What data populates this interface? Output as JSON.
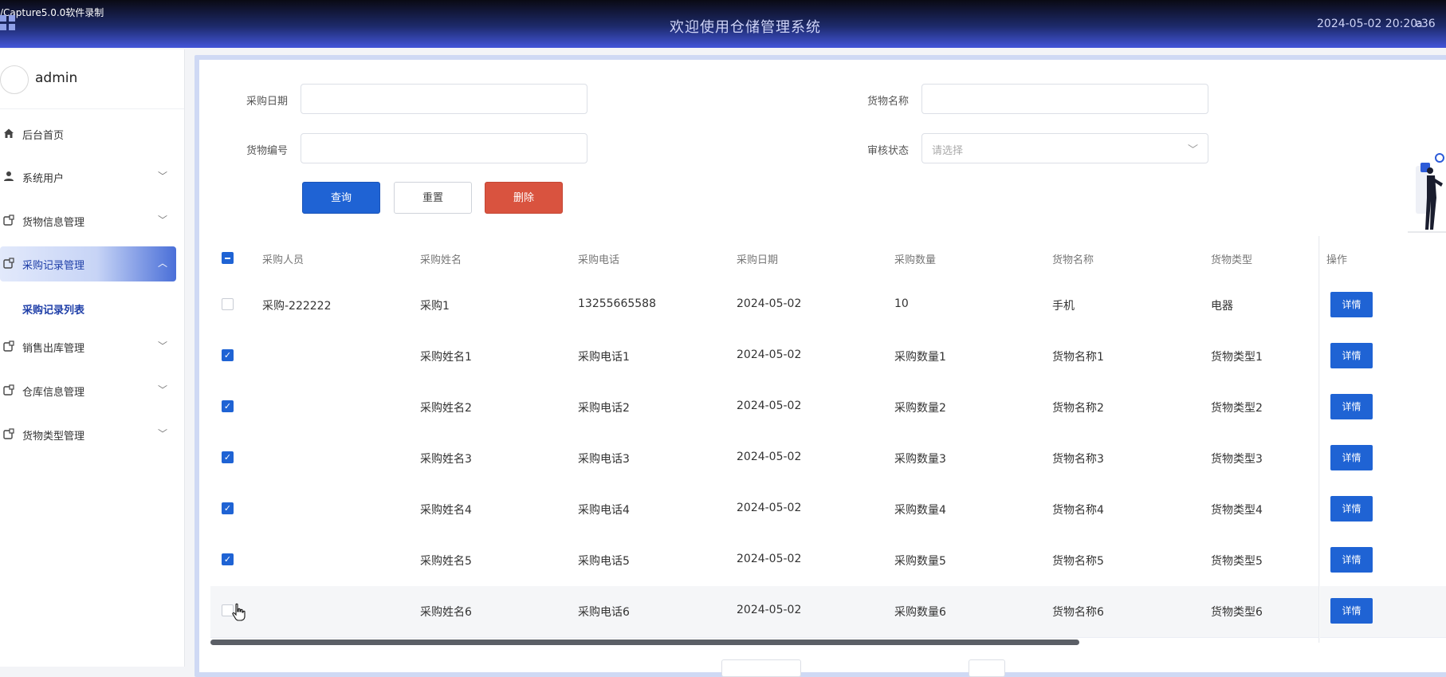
{
  "topbar": {
    "capture_text": "/Capture5.0.0软件录制",
    "title": "欢迎使用仓储管理系统",
    "datetime": "2024-05-02 20:20:36",
    "user_initial": "a"
  },
  "sidebar": {
    "username": "admin",
    "items": [
      {
        "label": "后台首页",
        "icon": "home-icon",
        "has_children": false
      },
      {
        "label": "系统用户",
        "icon": "user-icon",
        "has_children": true
      },
      {
        "label": "货物信息管理",
        "icon": "module-icon",
        "has_children": true
      },
      {
        "label": "采购记录管理",
        "icon": "module-icon",
        "has_children": true,
        "active": true
      },
      {
        "label": "销售出库管理",
        "icon": "module-icon",
        "has_children": true
      },
      {
        "label": "仓库信息管理",
        "icon": "module-icon",
        "has_children": true
      },
      {
        "label": "货物类型管理",
        "icon": "module-icon",
        "has_children": true
      }
    ],
    "submenu_active": "采购记录列表"
  },
  "filters": {
    "purchase_date_label": "采购日期",
    "goods_name_label": "货物名称",
    "goods_code_label": "货物编号",
    "audit_status_label": "审核状态",
    "audit_status_placeholder": "请选择"
  },
  "actions": {
    "query": "查询",
    "reset": "重置",
    "delete": "删除"
  },
  "table": {
    "headers": [
      "采购人员",
      "采购姓名",
      "采购电话",
      "采购日期",
      "采购数量",
      "货物名称",
      "货物类型",
      "操作"
    ],
    "detail_label": "详情",
    "rows": [
      {
        "checked": false,
        "person": "采购-222222",
        "name": "采购1",
        "phone": "13255665588",
        "date": "2024-05-02",
        "qty": "10",
        "goods": "手机",
        "type": "电器"
      },
      {
        "checked": true,
        "person": "",
        "name": "采购姓名1",
        "phone": "采购电话1",
        "date": "2024-05-02",
        "qty": "采购数量1",
        "goods": "货物名称1",
        "type": "货物类型1"
      },
      {
        "checked": true,
        "person": "",
        "name": "采购姓名2",
        "phone": "采购电话2",
        "date": "2024-05-02",
        "qty": "采购数量2",
        "goods": "货物名称2",
        "type": "货物类型2"
      },
      {
        "checked": true,
        "person": "",
        "name": "采购姓名3",
        "phone": "采购电话3",
        "date": "2024-05-02",
        "qty": "采购数量3",
        "goods": "货物名称3",
        "type": "货物类型3"
      },
      {
        "checked": true,
        "person": "",
        "name": "采购姓名4",
        "phone": "采购电话4",
        "date": "2024-05-02",
        "qty": "采购数量4",
        "goods": "货物名称4",
        "type": "货物类型4"
      },
      {
        "checked": true,
        "person": "",
        "name": "采购姓名5",
        "phone": "采购电话5",
        "date": "2024-05-02",
        "qty": "采购数量5",
        "goods": "货物名称5",
        "type": "货物类型5"
      },
      {
        "checked": false,
        "person": "",
        "name": "采购姓名6",
        "phone": "采购电话6",
        "date": "2024-05-02",
        "qty": "采购数量6",
        "goods": "货物名称6",
        "type": "货物类型6"
      }
    ]
  },
  "colors": {
    "primary": "#1f63d4",
    "danger": "#d9533f",
    "topbar_accent": "#4355d9"
  }
}
